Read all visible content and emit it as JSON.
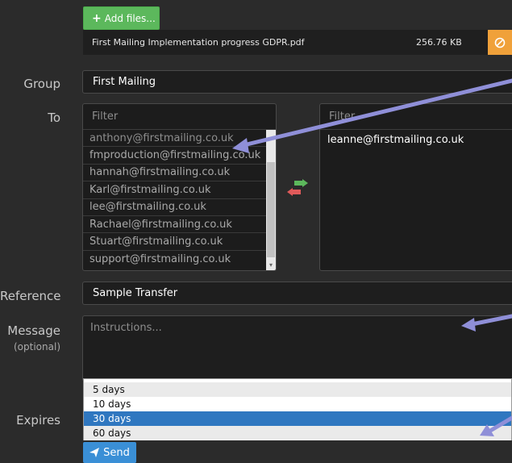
{
  "upload": {
    "add_files_label": "Add files...",
    "file": {
      "name": "First Mailing Implementation progress GDPR.pdf",
      "size": "256.76 KB"
    }
  },
  "labels": {
    "group": "Group",
    "to": "To",
    "reference": "Reference",
    "message": "Message",
    "message_optional": "(optional)",
    "expires": "Expires"
  },
  "group": {
    "value": "First Mailing"
  },
  "to": {
    "available": {
      "filter_placeholder": "Filter",
      "items": [
        "anthony@firstmailing.co.uk",
        "fmproduction@firstmailing.co.uk",
        "hannah@firstmailing.co.uk",
        "Karl@firstmailing.co.uk",
        "lee@firstmailing.co.uk",
        "Rachael@firstmailing.co.uk",
        "Stuart@firstmailing.co.uk",
        "support@firstmailing.co.uk"
      ]
    },
    "selected": {
      "filter_placeholder": "Filter",
      "items": [
        "leanne@firstmailing.co.uk"
      ]
    }
  },
  "reference": {
    "value": "Sample Transfer"
  },
  "message": {
    "placeholder": "Instructions..."
  },
  "expires": {
    "options": [
      "5 days",
      "10 days",
      "30 days",
      "60 days"
    ],
    "selected": "30 days"
  },
  "send_label": "Send",
  "colors": {
    "accent_green": "#5cb85c",
    "warning_orange": "#f0a13a",
    "selected_blue": "#2f77c0",
    "send_blue": "#3a8fd6",
    "annotation_arrow": "#8f8fd8"
  }
}
